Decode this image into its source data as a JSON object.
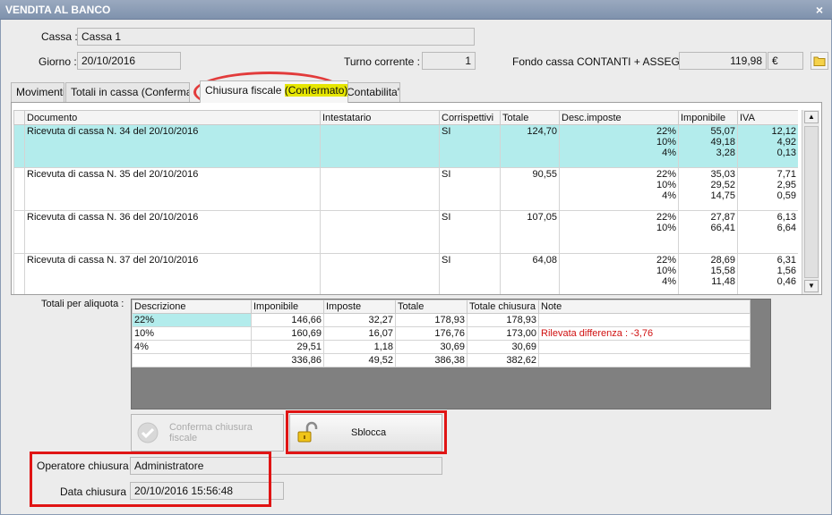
{
  "window": {
    "title": "VENDITA AL BANCO",
    "close": "×"
  },
  "header": {
    "cassa_label": "Cassa :",
    "cassa_value": "Cassa 1",
    "giorno_label": "Giorno :",
    "giorno_value": "20/10/2016",
    "turno_label": "Turno corrente :",
    "turno_value": "1",
    "fondo_label": "Fondo cassa CONTANTI + ASSEGNI :",
    "fondo_value": "119,98",
    "fondo_currency": "€"
  },
  "tabs": {
    "movimenti": "Movimenti",
    "totali": "Totali in cassa (Confermato)",
    "chiusura_prefix": "Chiusura fiscale ",
    "chiusura_status": "(Confermato)",
    "contabilita": "Contabilita'"
  },
  "grid": {
    "headers": [
      "Documento",
      "Intestatario",
      "Corrispettivi",
      "Totale",
      "Desc.imposte",
      "Imponibile",
      "IVA"
    ],
    "rows": [
      {
        "doc": "Ricevuta di cassa N. 34 del 20/10/2016",
        "intest": "",
        "corr": "SI",
        "totale": "124,70",
        "aliq": [
          "22%",
          "10%",
          "4%"
        ],
        "imp": [
          "55,07",
          "49,18",
          "3,28"
        ],
        "iva": [
          "12,12",
          "4,92",
          "0,13"
        ]
      },
      {
        "doc": "Ricevuta di cassa N. 35 del 20/10/2016",
        "intest": "",
        "corr": "SI",
        "totale": "90,55",
        "aliq": [
          "22%",
          "10%",
          "4%"
        ],
        "imp": [
          "35,03",
          "29,52",
          "14,75"
        ],
        "iva": [
          "7,71",
          "2,95",
          "0,59"
        ]
      },
      {
        "doc": "Ricevuta di cassa N. 36 del 20/10/2016",
        "intest": "",
        "corr": "SI",
        "totale": "107,05",
        "aliq": [
          "22%",
          "10%"
        ],
        "imp": [
          "27,87",
          "66,41"
        ],
        "iva": [
          "6,13",
          "6,64"
        ]
      },
      {
        "doc": "Ricevuta di cassa N. 37 del 20/10/2016",
        "intest": "",
        "corr": "SI",
        "totale": "64,08",
        "aliq": [
          "22%",
          "10%",
          "4%"
        ],
        "imp": [
          "28,69",
          "15,58",
          "11,48"
        ],
        "iva": [
          "6,31",
          "1,56",
          "0,46"
        ]
      }
    ]
  },
  "totali": {
    "label": "Totali per aliquota :",
    "headers": [
      "Descrizione",
      "Imponibile",
      "Imposte",
      "Totale",
      "Totale chiusura",
      "Note"
    ],
    "rows": [
      [
        "22%",
        "146,66",
        "32,27",
        "178,93",
        "178,93",
        ""
      ],
      [
        "10%",
        "160,69",
        "16,07",
        "176,76",
        "173,00",
        "Rilevata differenza : -3,76"
      ],
      [
        "4%",
        "29,51",
        "1,18",
        "30,69",
        "30,69",
        ""
      ],
      [
        "",
        "336,86",
        "49,52",
        "386,38",
        "382,62",
        ""
      ]
    ]
  },
  "buttons": {
    "conferma": "Conferma chiusura fiscale",
    "sblocca": "Sblocca"
  },
  "footer": {
    "operatore_label": "Operatore chiusura :",
    "operatore_value": "Administratore",
    "data_label": "Data chiusura :",
    "data_value": "20/10/2016 15:56:48"
  },
  "colors": {
    "selected_row": "#b3ecec",
    "highlight": "#e6e600",
    "annotation_red": "#e01414",
    "note_red": "#d01010"
  }
}
